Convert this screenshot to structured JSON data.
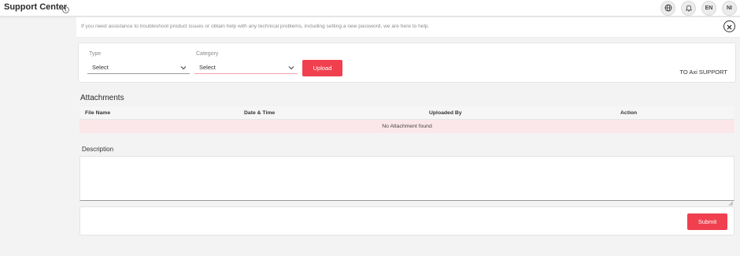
{
  "header": {
    "title": "Support Center",
    "info_icon": "info-circle-icon",
    "actions": {
      "globe_icon": "globe-icon",
      "bell_icon": "bell-icon",
      "language": "EN",
      "user_initials": "NI"
    }
  },
  "notice": {
    "text": "If you need assistance to troubleshoot product issues or obtain help with any technical problems, including setting a new password, we are here to help.",
    "close_icon": "close-icon"
  },
  "form": {
    "type": {
      "label": "Type",
      "value": "Select"
    },
    "category": {
      "label": "Category",
      "value": "Select"
    },
    "upload_label": "Upload",
    "support_text": "TO Axi SUPPORT"
  },
  "attachments": {
    "title": "Attachments",
    "columns": [
      "File Name",
      "Date & Time",
      "Uploaded By",
      "Action"
    ],
    "empty_text": "No Attachment found"
  },
  "description": {
    "label": "Description",
    "value": ""
  },
  "footer": {
    "submit_label": "Submit"
  },
  "colors": {
    "accent": "#f0404f",
    "empty_row_bg": "#fbe7e9",
    "page_bg": "#f3f3f4"
  }
}
